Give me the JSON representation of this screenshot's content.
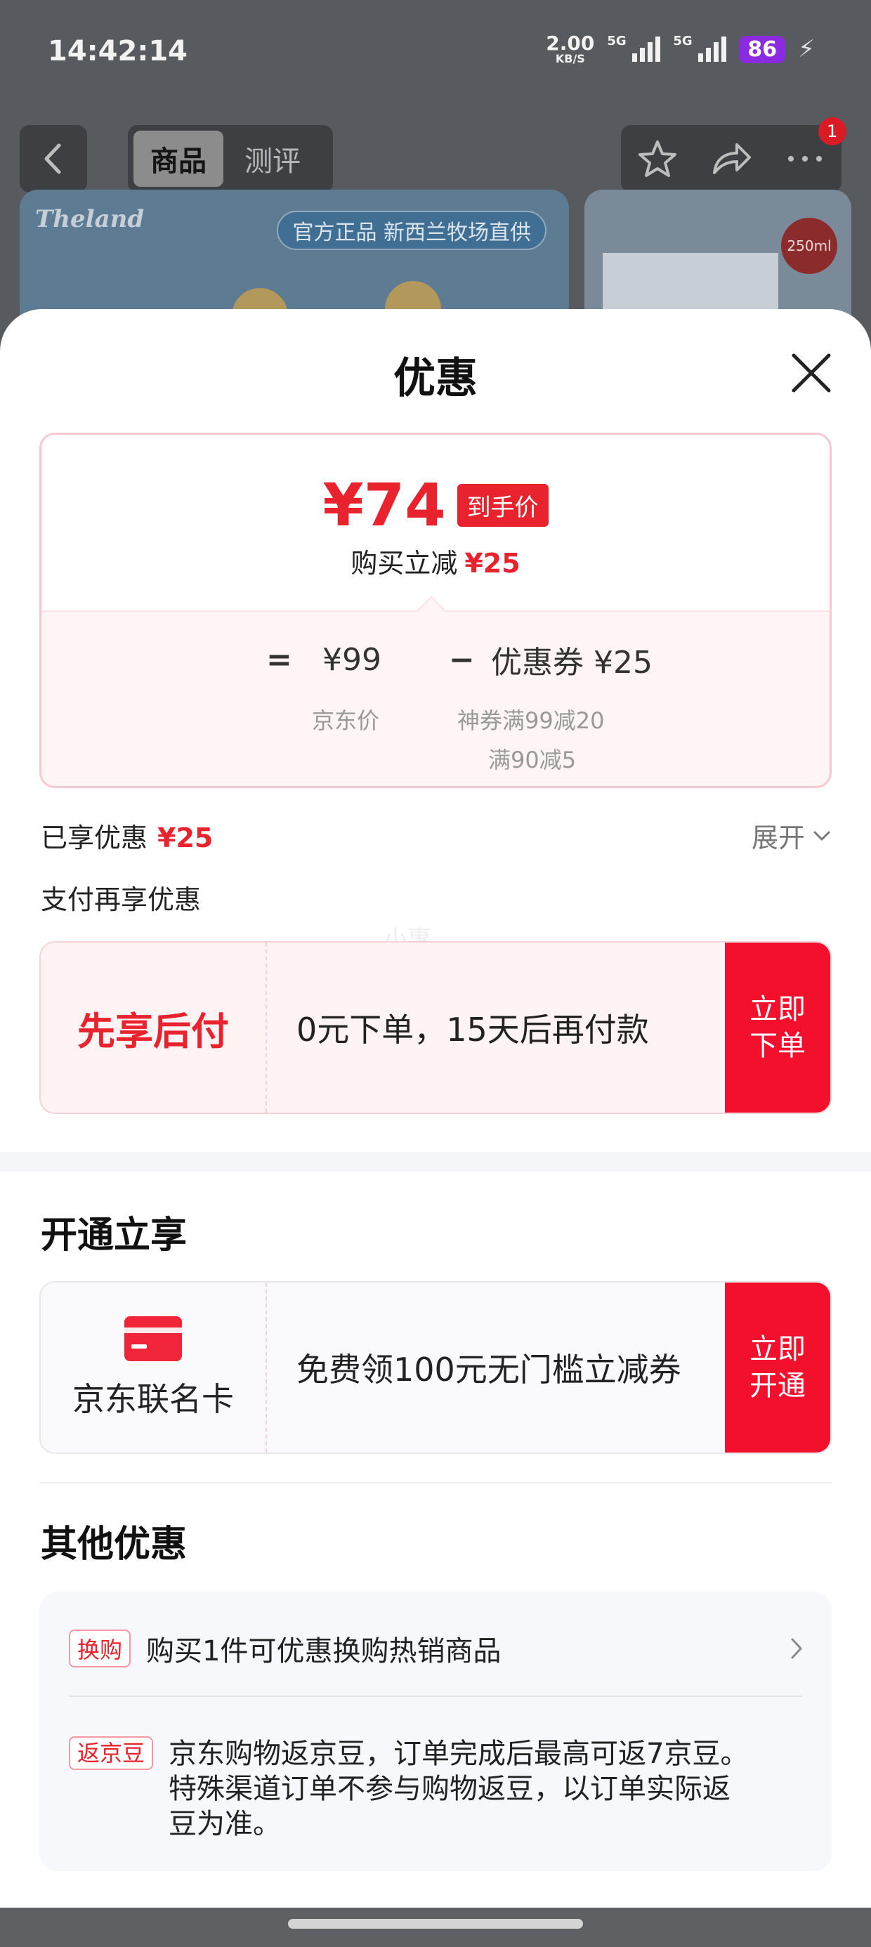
{
  "status_bar": {
    "time": "14:42:14",
    "net_speed": "2.00",
    "net_unit": "KB/S",
    "signal1_label": "5G",
    "signal2_label": "5G",
    "battery": "86"
  },
  "nav": {
    "tabs": [
      {
        "label": "商品",
        "active": true
      },
      {
        "label": "测评",
        "active": false
      }
    ],
    "cart_badge": "1"
  },
  "background_banner": {
    "brand": "Theland",
    "chip_text": "官方正品 新西兰牧场直供",
    "sticker": "250ml"
  },
  "sheet": {
    "title": "优惠",
    "price_card": {
      "final_price": "¥74",
      "final_tag": "到手价",
      "reduce_label": "购买立减",
      "reduce_amount": "¥25",
      "eq": "=",
      "jd_price": "¥99",
      "minus": "−",
      "coupon_label": "优惠券 ¥25",
      "jd_price_label": "京东价",
      "coupon_detail1": "神券满99减20",
      "coupon_detail2": "满90减5"
    },
    "enjoyed_label": "已享优惠",
    "enjoyed_amount": "¥25",
    "expand_label": "展开",
    "pay_more_label": "支付再享优惠",
    "watermark": "小惠",
    "bnpl": {
      "title": "先享后付",
      "desc": "0元下单，15天后再付款",
      "button": "立即\n下单"
    },
    "open_section_title": "开通立享",
    "jd_card": {
      "title": "京东联名卡",
      "desc": "免费领100元无门槛立减券",
      "button": "立即\n开通"
    },
    "other_section_title": "其他优惠",
    "other": [
      {
        "tag": "换购",
        "text": "购买1件可优惠换购热销商品"
      },
      {
        "tag": "返京豆",
        "text": "京东购物返京豆，订单完成后最高可返7京豆。特殊渠道订单不参与购物返豆，以订单实际返豆为准。"
      }
    ]
  },
  "colors": {
    "accent_red": "#e8232e",
    "button_red": "#f3102c",
    "battery_purple": "#8a2be2"
  }
}
